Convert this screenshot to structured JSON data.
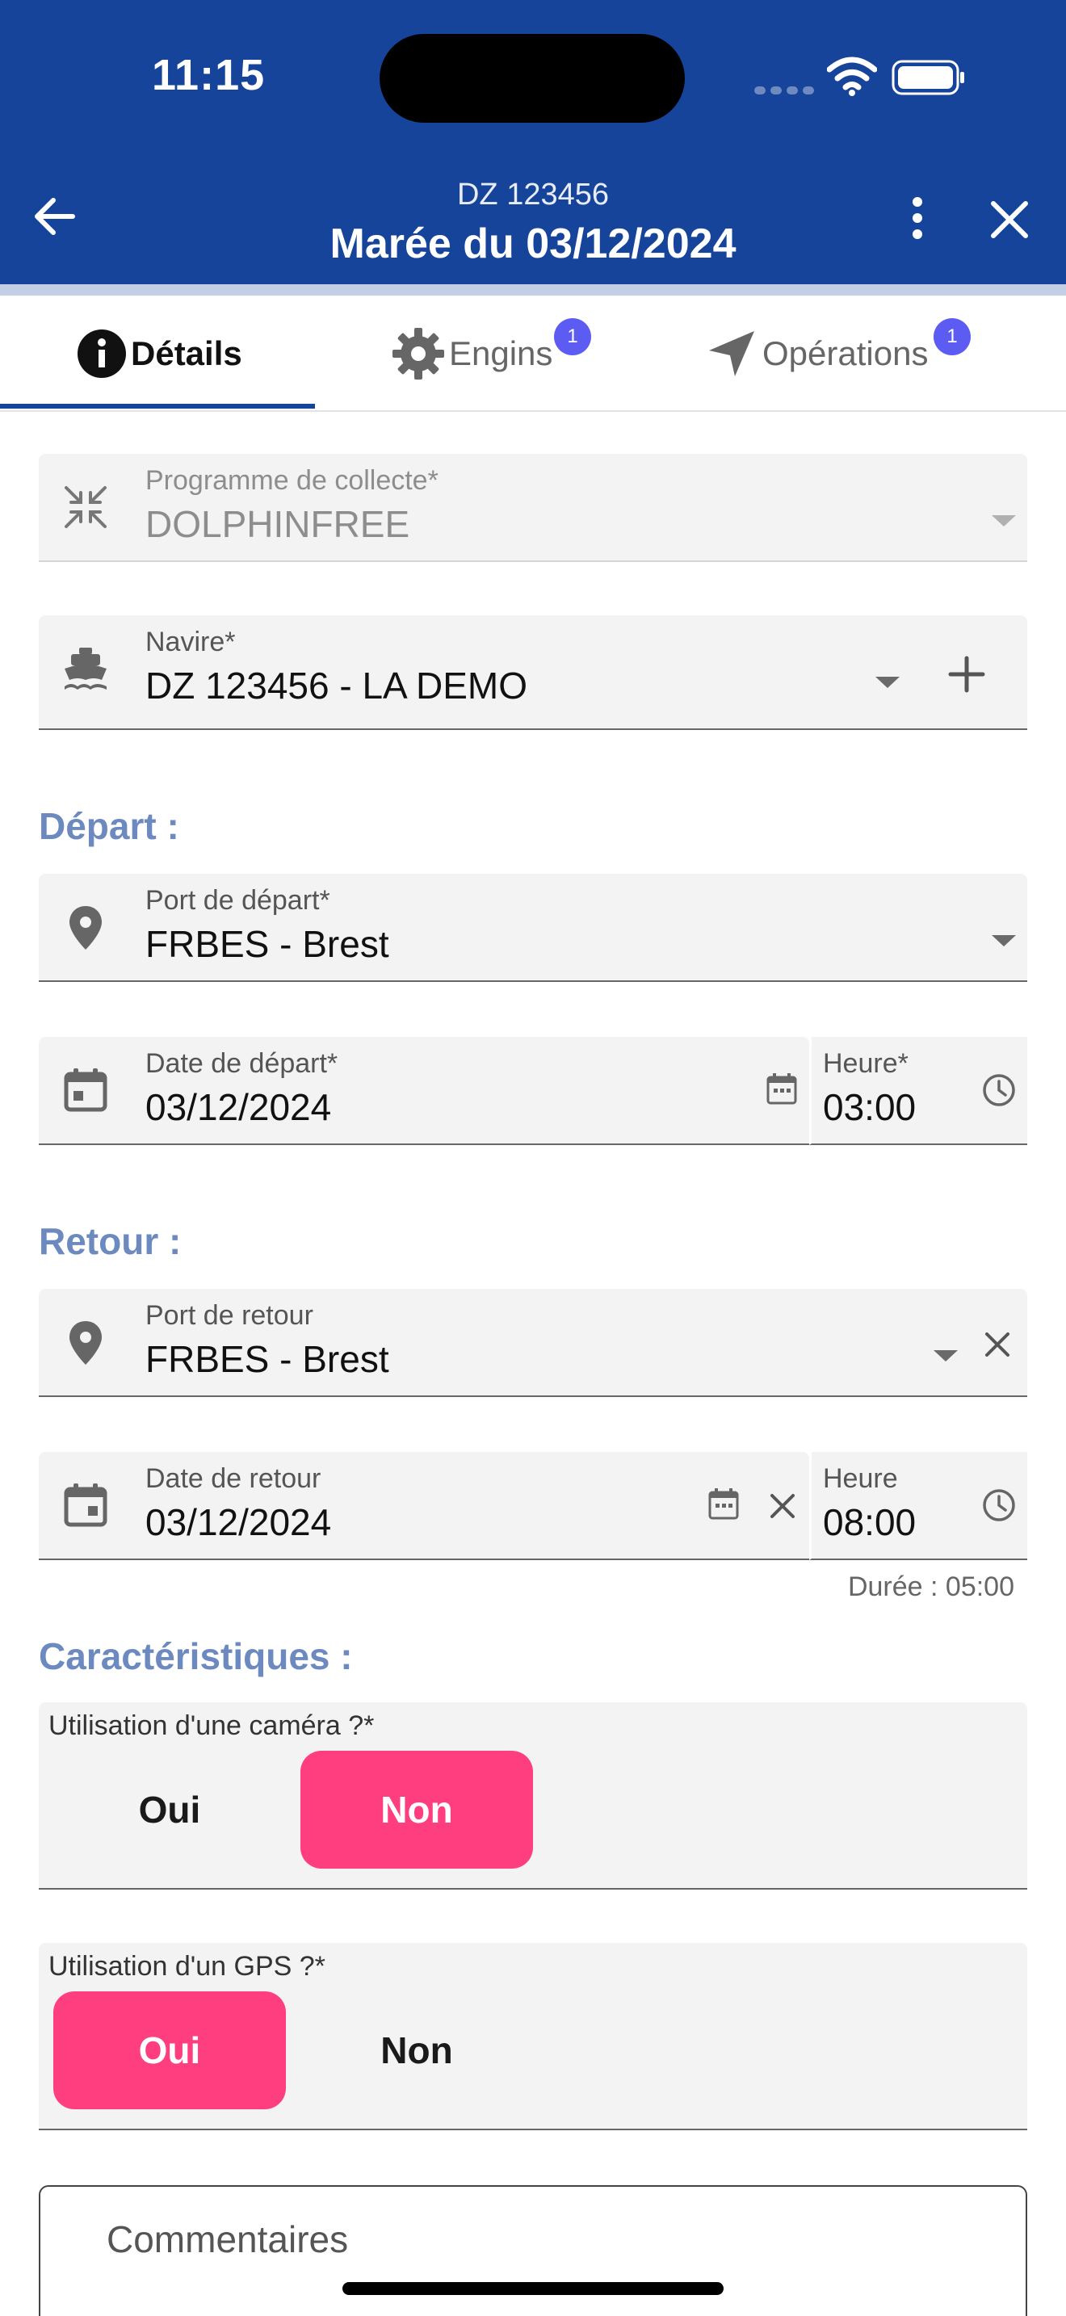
{
  "status_bar": {
    "time": "11:15"
  },
  "header": {
    "subtitle": "DZ 123456",
    "title": "Marée du 03/12/2024"
  },
  "tabs": [
    {
      "label": "Détails",
      "icon": "info-icon",
      "badge": ""
    },
    {
      "label": "Engins",
      "icon": "gear-icon",
      "badge": "1"
    },
    {
      "label": "Opérations",
      "icon": "navigation-arrow-icon",
      "badge": "1"
    }
  ],
  "fields": {
    "programme": {
      "label": "Programme de collecte*",
      "value": "DOLPHINFREE",
      "icon": "compress-icon"
    },
    "navire": {
      "label": "Navire*",
      "value": "DZ 123456 - LA DEMO",
      "icon": "boat-icon"
    }
  },
  "depart": {
    "section_title": "Départ :",
    "port_label": "Port de départ*",
    "port_value": "FRBES - Brest",
    "date_label": "Date de départ*",
    "date_value": "03/12/2024",
    "time_label": "Heure*",
    "time_value": "03:00"
  },
  "retour": {
    "section_title": "Retour :",
    "port_label": "Port de retour",
    "port_value": "FRBES - Brest",
    "date_label": "Date de retour",
    "date_value": "03/12/2024",
    "time_label": "Heure",
    "time_value": "08:00",
    "duration": "Durée :  05:00"
  },
  "caracteristiques": {
    "section_title": "Caractéristiques :",
    "camera": {
      "label": "Utilisation d'une caméra ?*",
      "options": [
        "Oui",
        "Non"
      ],
      "selected": "Non"
    },
    "gps": {
      "label": "Utilisation d'un GPS ?*",
      "options": [
        "Oui",
        "Non"
      ],
      "selected": "Oui"
    }
  },
  "comments": {
    "placeholder": "Commentaires"
  },
  "colors": {
    "appbar": "#15449a",
    "section_title": "#6d8ac0",
    "toggle_on": "#ff3e7f",
    "badge": "#5d5cf2"
  }
}
